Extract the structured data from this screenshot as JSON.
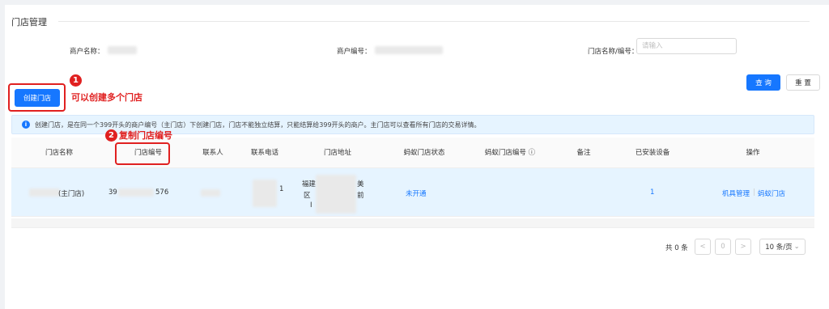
{
  "section": {
    "title": "门店管理"
  },
  "filters": {
    "merchant_name_label": "商户名称：",
    "merchant_no_label": "商户编号：",
    "store_label": "门店名称/编号：",
    "store_placeholder": "请输入",
    "query_label": "查 询",
    "reset_label": "重 置"
  },
  "create_button": {
    "label": "创建门店"
  },
  "annotations": {
    "one": {
      "num": "1",
      "text": "可以创建多个门店"
    },
    "two": {
      "num": "2",
      "text": "复制门店编号"
    }
  },
  "info": {
    "text": "创建门店，是在同一个399开头的商户编号（主门店）下创建门店，门店不能独立结算，只能结算给399开头的商户。主门店可以查看所有门店的交易详情。"
  },
  "table": {
    "headers": [
      "门店名称",
      "门店编号",
      "联系人",
      "联系电话",
      "门店地址",
      "蚂蚁门店状态",
      "蚂蚁门店编号 ⓘ",
      "备注",
      "已安装设备",
      "操作"
    ],
    "row": {
      "name_suffix": "(主门店)",
      "code_prefix": "39",
      "code_suffix": "576",
      "phone_suffix": "1",
      "addr_line1_start": "福建",
      "addr_line1_end": "美",
      "addr_line2_start": "区",
      "addr_line2_end": "前",
      "addr_line3": "I",
      "ant_status": "未开通",
      "devices": "1",
      "action_machine": "机具管理",
      "action_sep": "|",
      "action_ant": "蚂蚁门店"
    }
  },
  "pagination": {
    "total": "共 0 条",
    "prev": "<",
    "page": "0",
    "next": ">",
    "page_size": "10 条/页"
  },
  "colors": {
    "primary": "#1677ff",
    "annotation": "#e02020",
    "row_highlight": "#e6f4ff"
  }
}
